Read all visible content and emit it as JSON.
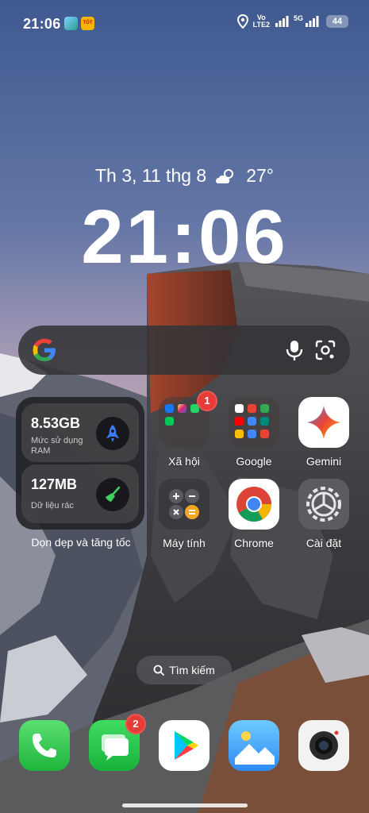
{
  "status_bar": {
    "time": "21:06",
    "notif_b_text": "TỐT",
    "volte_top": "Vo",
    "volte_bottom": "LTE2",
    "net_type": "5G",
    "battery": "44"
  },
  "lock_info": {
    "date": "Th 3, 11 thg 8",
    "temperature": "27°",
    "clock": "21:06"
  },
  "widget": {
    "ram_value": "8.53GB",
    "ram_label": "Mức sử dụng RAM",
    "junk_value": "127MB",
    "junk_label": "Dữ liệu rác",
    "caption": "Dọn dẹp và tăng tốc"
  },
  "apps": {
    "xa_hoi": "Xã hội",
    "xa_hoi_badge": "1",
    "google": "Google",
    "gemini": "Gemini",
    "may_tinh": "Máy tính",
    "chrome": "Chrome",
    "cai_dat": "Cài đặt"
  },
  "search_pill": "Tìm kiếm",
  "dock": {
    "messages_badge": "2"
  },
  "colors": {
    "sky_top": "#425a8f",
    "sky_bottom": "#c9a3a6",
    "badge_red": "#e63b36",
    "phone_green": "#2ecc52"
  }
}
